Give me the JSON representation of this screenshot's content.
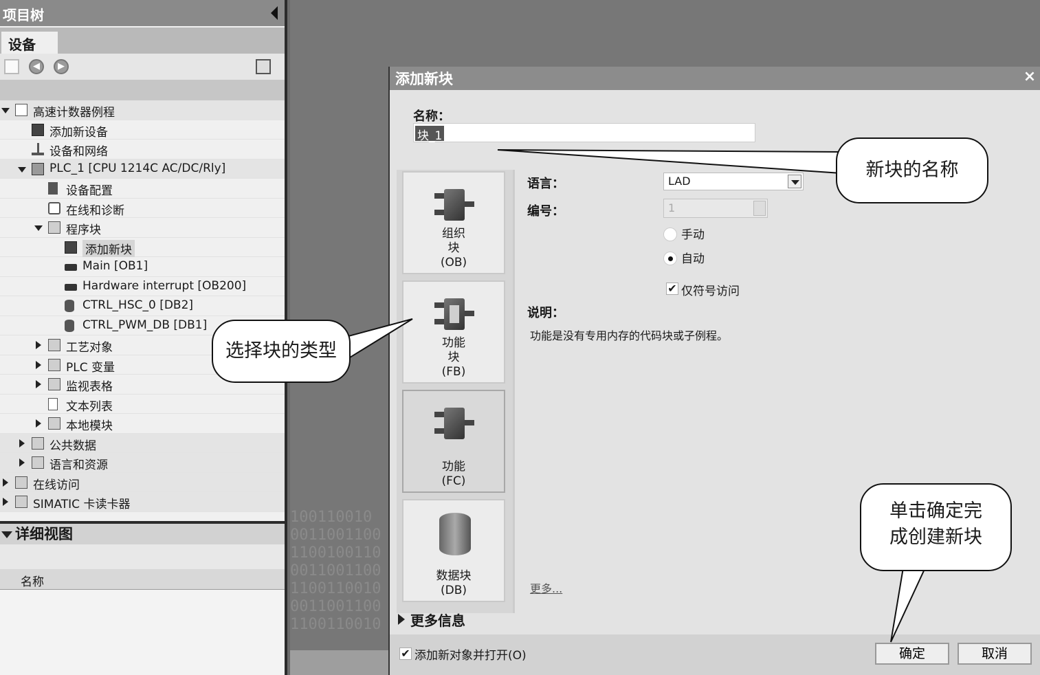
{
  "project_tree": {
    "title": "项目树",
    "tab": "设备",
    "items": [
      {
        "label": "高速计数器例程",
        "depth": 0,
        "toggle": "open",
        "icon": "project-icon",
        "shade": true
      },
      {
        "label": "添加新设备",
        "depth": 1,
        "toggle": "none",
        "icon": "add-device-icon"
      },
      {
        "label": "设备和网络",
        "depth": 1,
        "toggle": "none",
        "icon": "network-icon"
      },
      {
        "label": "PLC_1 [CPU 1214C AC/DC/Rly]",
        "depth": 1,
        "toggle": "open",
        "icon": "plc-icon",
        "shade": true
      },
      {
        "label": "设备配置",
        "depth": 2,
        "toggle": "none",
        "icon": "device-config-icon"
      },
      {
        "label": "在线和诊断",
        "depth": 2,
        "toggle": "none",
        "icon": "diagnostics-icon"
      },
      {
        "label": "程序块",
        "depth": 2,
        "toggle": "open",
        "icon": "folder-icon"
      },
      {
        "label": "添加新块",
        "depth": 3,
        "toggle": "none",
        "icon": "add-block-icon",
        "selected": true
      },
      {
        "label": "Main [OB1]",
        "depth": 3,
        "toggle": "none",
        "icon": "block-icon"
      },
      {
        "label": "Hardware interrupt [OB200]",
        "depth": 3,
        "toggle": "none",
        "icon": "block-icon"
      },
      {
        "label": "CTRL_HSC_0 [DB2]",
        "depth": 3,
        "toggle": "none",
        "icon": "data-block-icon"
      },
      {
        "label": "CTRL_PWM_DB [DB1]",
        "depth": 3,
        "toggle": "none",
        "icon": "data-block-icon"
      },
      {
        "label": "工艺对象",
        "depth": 2,
        "toggle": "closed",
        "icon": "folder-icon"
      },
      {
        "label": "PLC 变量",
        "depth": 2,
        "toggle": "closed",
        "icon": "folder-icon"
      },
      {
        "label": "监视表格",
        "depth": 2,
        "toggle": "closed",
        "icon": "folder-icon"
      },
      {
        "label": "文本列表",
        "depth": 2,
        "toggle": "none",
        "icon": "list-icon"
      },
      {
        "label": "本地模块",
        "depth": 2,
        "toggle": "closed",
        "icon": "folder-icon"
      },
      {
        "label": "公共数据",
        "depth": 1,
        "toggle": "closed",
        "icon": "folder-icon",
        "shade": true
      },
      {
        "label": "语言和资源",
        "depth": 1,
        "toggle": "closed",
        "icon": "folder-icon",
        "shade": true
      },
      {
        "label": "在线访问",
        "depth": 0,
        "toggle": "closed",
        "icon": "online-icon",
        "shade": true
      },
      {
        "label": "SIMATIC 卡读卡器",
        "depth": 0,
        "toggle": "closed",
        "icon": "card-reader-icon",
        "shade": true
      }
    ]
  },
  "detail_view": {
    "title": "详细视图",
    "column_name": "名称"
  },
  "background_binary": "100110010\n0011001100\n1100100110\n0011001100\n1100110010\n0011001100\n1100110010",
  "dialog": {
    "title": "添加新块",
    "close": "×",
    "name_label": "名称：",
    "name_value": "块_1",
    "block_types": [
      {
        "line1": "组织",
        "line2": "块",
        "code": "(OB)",
        "kind": "ob"
      },
      {
        "line1": "功能",
        "line2": "块",
        "code": "(FB)",
        "kind": "fb"
      },
      {
        "line1": "",
        "line2": "功能",
        "code": "(FC)",
        "kind": "fc"
      },
      {
        "line1": "",
        "line2": "数据块",
        "code": "(DB)",
        "kind": "db"
      }
    ],
    "language_label": "语言：",
    "language_value": "LAD",
    "number_label": "编号：",
    "number_value": "1",
    "manual_label": "手动",
    "auto_label": "自动",
    "symbolic_access_label": "仅符号访问",
    "symbolic_check": "✔",
    "description_label": "说明：",
    "description_text": "功能是没有专用内存的代码块或子例程。",
    "more_link": "更多...",
    "more_info": "更多信息",
    "open_after_add_label": "添加新对象并打开(O)",
    "open_check": "✔",
    "ok_label": "确定",
    "cancel_label": "取消"
  },
  "callouts": {
    "block_name": "新块的名称",
    "block_type": "选择块的类型",
    "confirm_line1": "单击确定完",
    "confirm_line2": "成创建新块"
  }
}
